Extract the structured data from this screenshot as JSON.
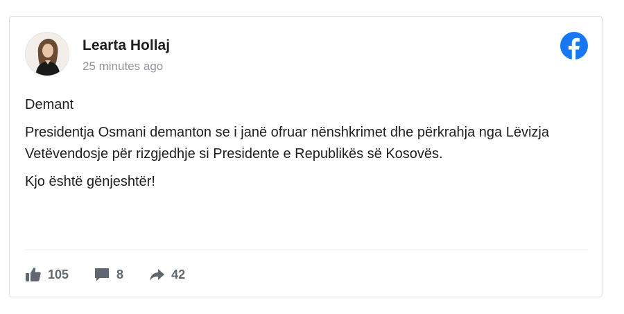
{
  "post": {
    "author": "Learta Hollaj",
    "time": "25 minutes ago",
    "paragraphs": [
      "Demant",
      "Presidentja Osmani demanton se i janë ofruar nënshkrimet dhe përkrahja nga Lëvizja Vetëvendosje për rizgjedhje si Presidente e Republikës së Kosovës.",
      "Kjo është gënjeshtër!"
    ],
    "likes": "105",
    "comments": "8",
    "shares": "42"
  },
  "icons": {
    "platform": "facebook-icon",
    "like": "thumbs-up-icon",
    "comment": "comment-bubble-icon",
    "share": "share-arrow-icon"
  },
  "colors": {
    "facebook_blue": "#1877f2",
    "action_gray": "#606770",
    "timestamp_gray": "#90949c"
  }
}
